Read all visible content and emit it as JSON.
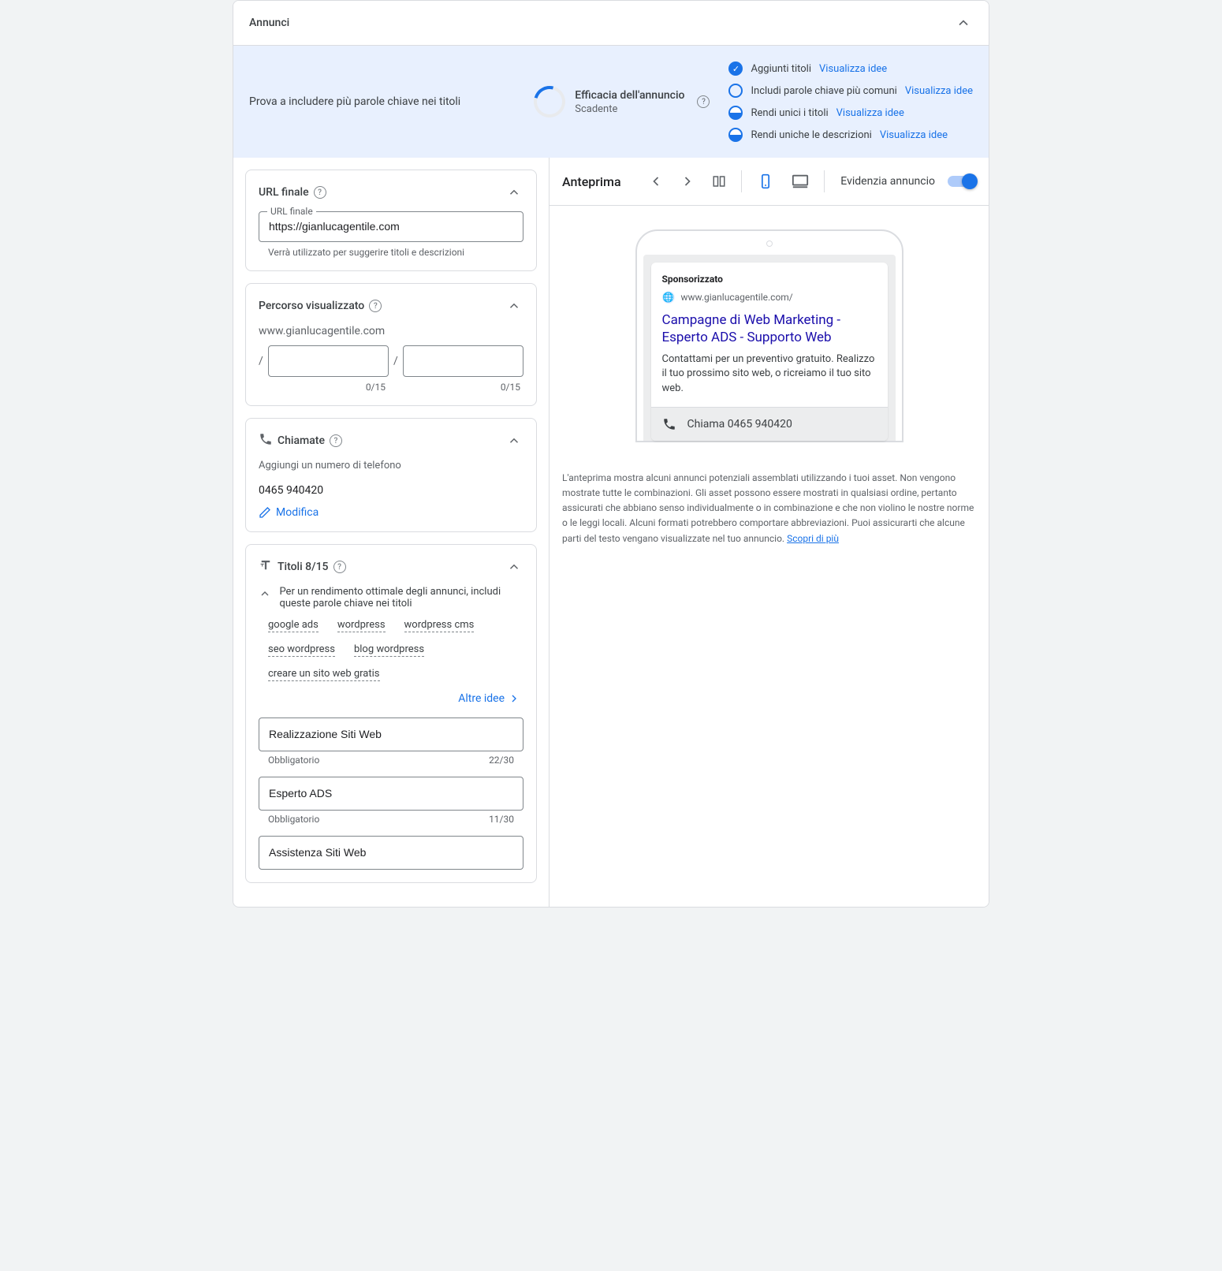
{
  "header": {
    "title": "Annunci"
  },
  "tip": {
    "text": "Prova a includere più parole chiave nei titoli",
    "efficacy_label": "Efficacia dell'annuncio",
    "efficacy_value": "Scadente"
  },
  "checklist": {
    "item1": {
      "text": "Aggiunti titoli",
      "link": "Visualizza idee"
    },
    "item2": {
      "text": "Includi parole chiave più comuni",
      "link": "Visualizza idee"
    },
    "item3": {
      "text": "Rendi unici i titoli",
      "link": "Visualizza idee"
    },
    "item4": {
      "text": "Rendi uniche le descrizioni",
      "link": "Visualizza idee"
    }
  },
  "final_url": {
    "title": "URL finale",
    "field_label": "URL finale",
    "value": "https://gianlucagentile.com",
    "helper": "Verrà utilizzato per suggerire titoli e descrizioni"
  },
  "display_path": {
    "title": "Percorso visualizzato",
    "domain": "www.gianlucagentile.com",
    "counter1": "0/15",
    "counter2": "0/15"
  },
  "calls": {
    "title": "Chiamate",
    "subtitle": "Aggiungi un numero di telefono",
    "number": "0465 940420",
    "edit": "Modifica"
  },
  "titles": {
    "title": "Titoli 8/15",
    "tip": "Per un rendimento ottimale degli annunci, includi queste parole chiave nei titoli",
    "keywords": [
      "google ads",
      "wordpress",
      "wordpress cms",
      "seo wordpress",
      "blog wordpress",
      "creare un sito web gratis"
    ],
    "more_ideas": "Altre idee",
    "items": [
      {
        "value": "Realizzazione Siti Web",
        "req": "Obbligatorio",
        "count": "22/30"
      },
      {
        "value": "Esperto ADS",
        "req": "Obbligatorio",
        "count": "11/30"
      },
      {
        "value": "Assistenza Siti Web",
        "req": "",
        "count": ""
      }
    ]
  },
  "preview": {
    "title": "Anteprima",
    "highlight_label": "Evidenzia annuncio",
    "ad": {
      "sponsored": "Sponsorizzato",
      "url": "www.gianlucagentile.com/",
      "title": "Campagne di Web Marketing - Esperto ADS - Supporto Web",
      "desc": "Contattami per un preventivo gratuito. Realizzo il tuo prossimo sito web, o ricreiamo il tuo sito web.",
      "call": "Chiama 0465 940420"
    },
    "disclaimer": "L'anteprima mostra alcuni annunci potenziali assemblati utilizzando i tuoi asset. Non vengono mostrate tutte le combinazioni. Gli asset possono essere mostrati in qualsiasi ordine, pertanto assicurati che abbiano senso individualmente o in combinazione e che non violino le nostre norme o le leggi locali. Alcuni formati potrebbero comportare abbreviazioni. Puoi assicurarti che alcune parti del testo vengano visualizzate nel tuo annuncio. ",
    "learn_more": "Scopri di più"
  }
}
